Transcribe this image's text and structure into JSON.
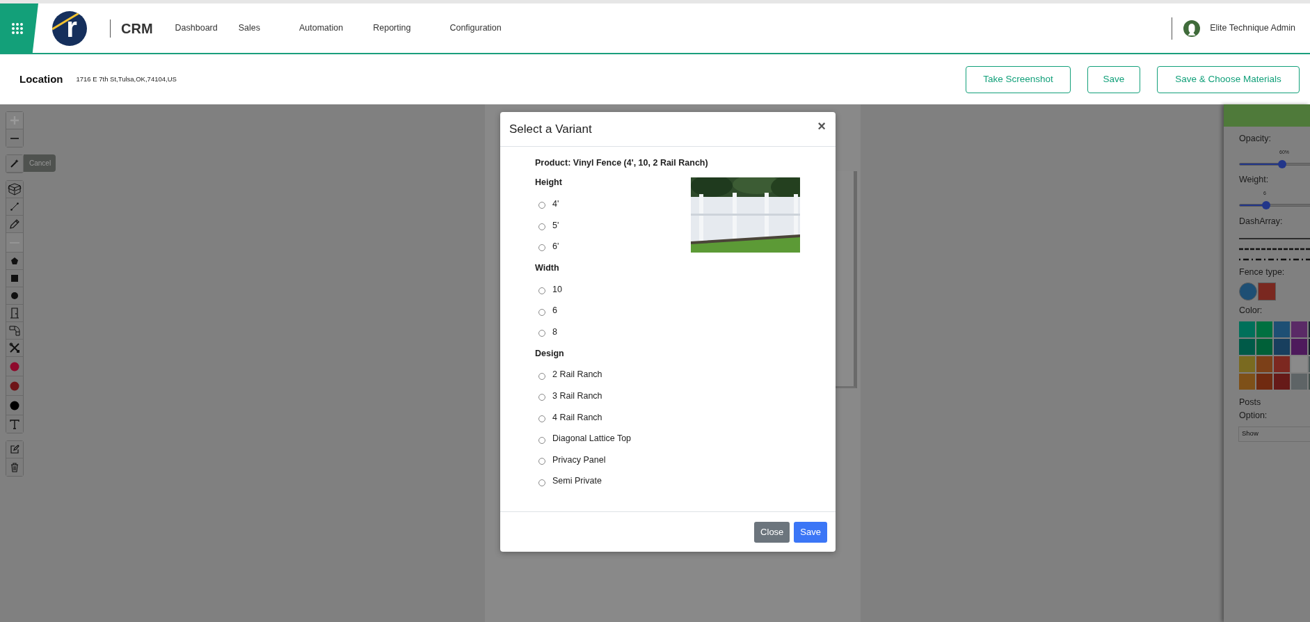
{
  "app": {
    "logo_letter": "r",
    "title": "CRM",
    "user": "Elite Technique Admin"
  },
  "nav": [
    {
      "label": "Dashboard"
    },
    {
      "label": "Sales"
    },
    {
      "label": "Automation"
    },
    {
      "label": "Reporting"
    },
    {
      "label": "Configuration"
    }
  ],
  "location": {
    "label": "Location",
    "address": "1716 E 7th St,Tulsa,OK,74104,US"
  },
  "actions": [
    {
      "label": "Take Screenshot"
    },
    {
      "label": "Save"
    },
    {
      "label": "Save & Choose Materials"
    }
  ],
  "toolbar": {
    "tooltip": "Cancel",
    "groups": [
      [
        {
          "kind": "zoom-in",
          "disabled": true
        },
        {
          "kind": "zoom-out",
          "disabled": false
        }
      ],
      [
        {
          "kind": "wand",
          "disabled": false
        }
      ],
      [
        {
          "kind": "box",
          "disabled": false
        },
        {
          "kind": "line",
          "disabled": false
        },
        {
          "kind": "pencil",
          "disabled": false
        },
        {
          "kind": "dash",
          "disabled": true
        },
        {
          "kind": "pentagon",
          "disabled": false
        },
        {
          "kind": "square",
          "disabled": false
        },
        {
          "kind": "circle",
          "disabled": false
        },
        {
          "kind": "door",
          "disabled": false
        },
        {
          "kind": "elbow",
          "disabled": false
        },
        {
          "kind": "tools",
          "disabled": false
        },
        {
          "kind": "marker",
          "color": "#8e0a2c",
          "disabled": false
        },
        {
          "kind": "marker",
          "color": "#6e1418",
          "disabled": false
        },
        {
          "kind": "marker",
          "color": "#000000",
          "disabled": false
        },
        {
          "kind": "text",
          "disabled": false
        }
      ],
      [
        {
          "kind": "edit",
          "disabled": false
        },
        {
          "kind": "trash",
          "disabled": false
        }
      ]
    ]
  },
  "style_panel": {
    "opacity": {
      "label": "Opacity:",
      "reading": "60%",
      "level": 0.6
    },
    "weight": {
      "label": "Weight:",
      "reading": "6",
      "level": 0.375
    },
    "dash_label": "DashArray:",
    "dash_styles": [
      {
        "kind": "solid"
      },
      {
        "kind": "dashed"
      },
      {
        "kind": "dash-dot"
      }
    ],
    "fence_type_label": "Fence type:",
    "fence_types": [
      {
        "kind": "circle",
        "color": "#1e4f74"
      },
      {
        "kind": "square",
        "color": "#7a2820"
      }
    ],
    "color_label": "Color:",
    "swatches": [
      [
        {
          "color": "#00705a"
        },
        {
          "color": "#007040"
        },
        {
          "color": "#1e4f74"
        },
        {
          "color": "#5a2a66"
        },
        {
          "color": "#1a2530"
        }
      ],
      [
        {
          "color": "#005a48"
        },
        {
          "color": "#006038"
        },
        {
          "color": "#183f5e"
        },
        {
          "color": "#4e1a5c"
        },
        {
          "color": "#151e28"
        }
      ],
      [
        {
          "color": "#7a6a20"
        },
        {
          "color": "#7c4018"
        },
        {
          "color": "#7c2820"
        },
        {
          "color": "#8a8a8a"
        },
        {
          "color": "#4d5a5a"
        }
      ],
      [
        {
          "color": "#7e5018"
        },
        {
          "color": "#702a10"
        },
        {
          "color": "#661a18"
        },
        {
          "color": "#5e6466"
        },
        {
          "color": "#44504e"
        }
      ]
    ],
    "posts_label": "Posts",
    "option_label": "Option:",
    "option_value": "Show"
  },
  "modal": {
    "title": "Select a Variant",
    "close": "×",
    "product": "Product: Vinyl Fence (4', 10, 2 Rail Ranch)",
    "groups": [
      {
        "label": "Height",
        "options": [
          {
            "label": "4'",
            "selected": false
          },
          {
            "label": "5'",
            "selected": false
          },
          {
            "label": "6'",
            "selected": false
          }
        ]
      },
      {
        "label": "Width",
        "options": [
          {
            "label": "10",
            "selected": false
          },
          {
            "label": "6",
            "selected": false
          },
          {
            "label": "8",
            "selected": false
          }
        ]
      },
      {
        "label": "Design",
        "options": [
          {
            "label": "2 Rail Ranch",
            "selected": false
          },
          {
            "label": "3 Rail Ranch",
            "selected": false
          },
          {
            "label": "4 Rail Ranch",
            "selected": false
          },
          {
            "label": "Diagonal Lattice Top",
            "selected": false
          },
          {
            "label": "Privacy Panel",
            "selected": false
          },
          {
            "label": "Semi Private",
            "selected": false
          }
        ]
      }
    ],
    "buttons": [
      {
        "label": "Close",
        "kind": "secondary"
      },
      {
        "label": "Save",
        "kind": "primary"
      }
    ]
  }
}
